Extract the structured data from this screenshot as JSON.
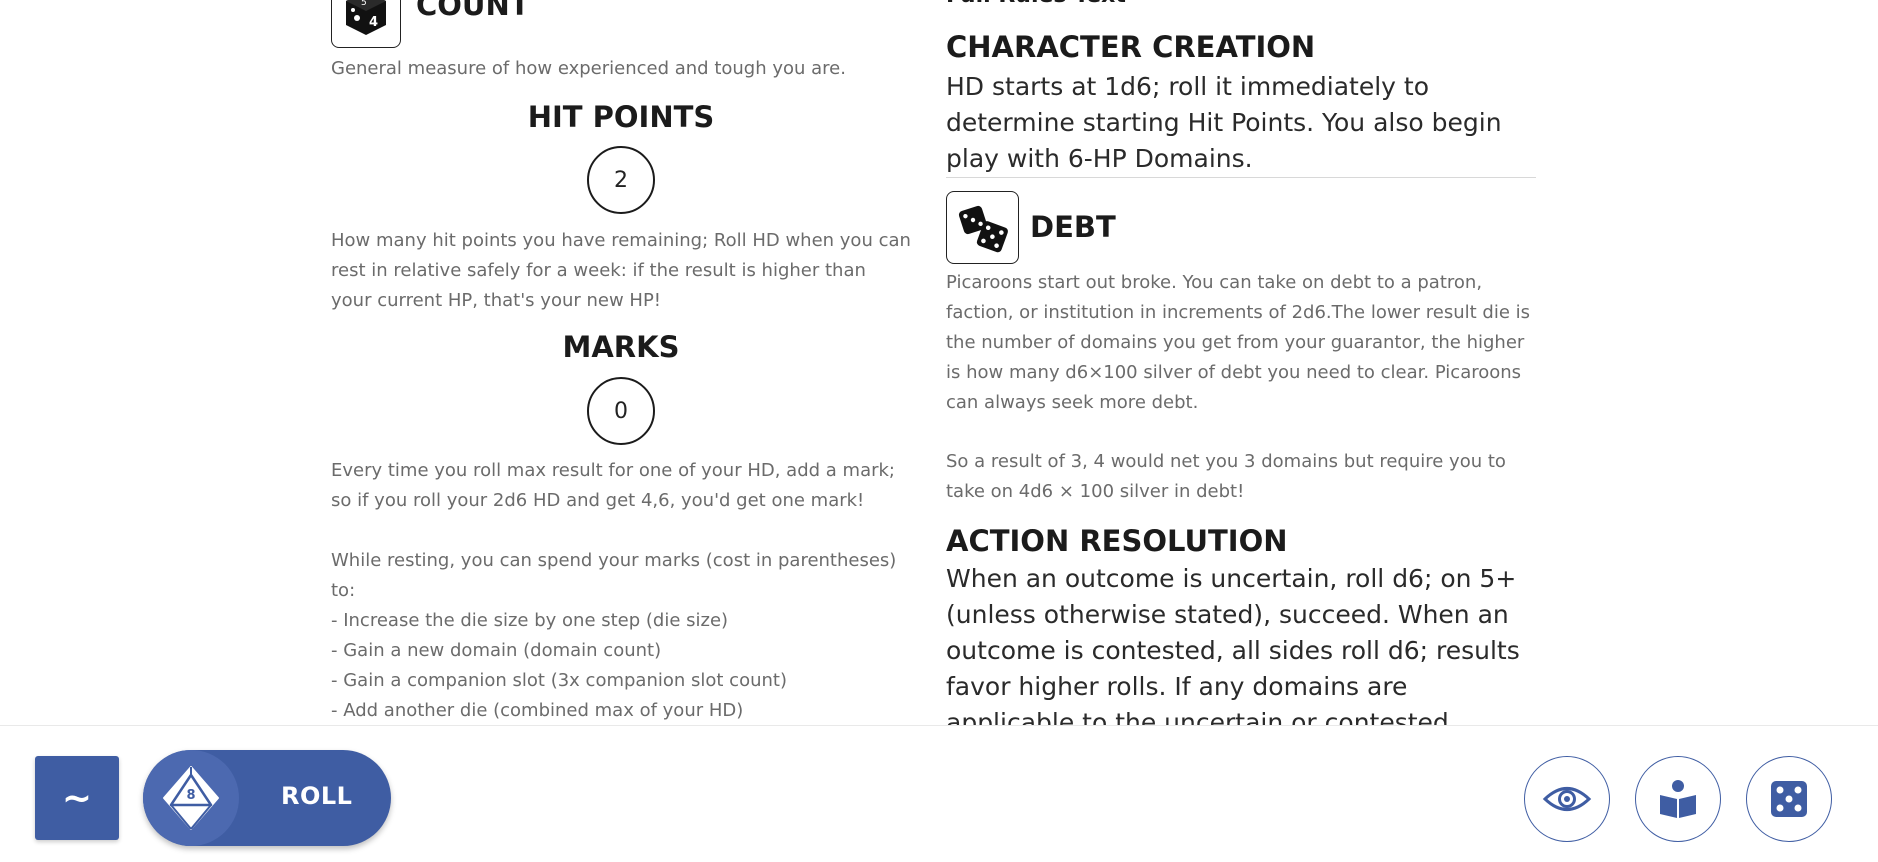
{
  "count": {
    "title": "COUNT",
    "icon": "dice-cube-icon",
    "description": "General measure of how experienced and tough you are."
  },
  "hit_points": {
    "title": "HIT POINTS",
    "value": "2",
    "description": "How many hit points you have remaining; Roll HD when you can rest in relative safely for a week: if the result is higher than your current HP, that's your new HP!"
  },
  "marks": {
    "title": "MARKS",
    "value": "0",
    "description1": "Every time you roll max result for one of your HD, add a mark; so if you roll your 2d6 HD and get 4,6, you'd get one mark!",
    "description2": "While resting, you can spend your marks (cost in parentheses) to:",
    "options": [
      "- Increase the die size by one step (die size)",
      "- Gain a new domain (domain count)",
      "- Gain a companion slot (3x companion slot count)",
      "- Add another die (combined max of your HD)"
    ]
  },
  "right": {
    "partial_heading": "Full Rules Text",
    "character_creation": {
      "title": "CHARACTER CREATION",
      "text": "HD starts at 1d6; roll it immediately to determine starting Hit Points. You also begin play with 6-HP Domains."
    },
    "debt": {
      "title": "DEBT",
      "icon": "two-dice-icon",
      "paragraph1": "Picaroons start out broke. You can take on debt to a patron, faction, or institution in increments of 2d6.The lower result die is the number of domains you get from your guarantor, the higher is how many d6×100 silver of debt you need to clear. Picaroons can always seek more debt.",
      "paragraph2": "So a result of 3, 4 would net you 3 domains but require you to take on 4d6 × 100 silver in debt!"
    },
    "action_resolution": {
      "title": "ACTION RESOLUTION",
      "text": "When an outcome is uncertain, roll d6; on 5+ (unless otherwise stated), succeed. When an outcome is contested, all sides roll d6; results favor higher rolls. If any domains are applicable to the uncertain or contested action, roll the highest"
    }
  },
  "footer": {
    "tilde_label": "~",
    "roll_label": "ROLL",
    "roll_die_value": "8",
    "buttons": [
      "eye-icon",
      "book-reader-icon",
      "dice-five-icon"
    ]
  },
  "colors": {
    "accent": "#3f5da3",
    "muted_text": "#6b6b6b",
    "heading": "#1b1b1b"
  }
}
